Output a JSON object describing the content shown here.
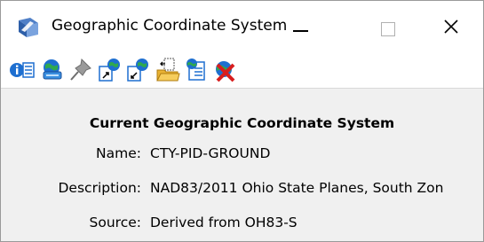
{
  "window": {
    "title": "Geographic Coordinate System",
    "app_icon": "geo-app-icon",
    "controls": {
      "minimize_icon": "minimize-icon",
      "maximize_icon": "maximize-icon",
      "close_icon": "close-icon"
    }
  },
  "toolbar": {
    "tools": [
      {
        "name": "info-list-icon"
      },
      {
        "name": "globe-database-icon"
      },
      {
        "name": "pushpin-icon"
      },
      {
        "name": "export-globe-icon"
      },
      {
        "name": "import-globe-icon"
      },
      {
        "name": "open-folder-icon"
      },
      {
        "name": "globe-list-icon"
      },
      {
        "name": "delete-globe-icon"
      }
    ]
  },
  "panel": {
    "heading": "Current Geographic Coordinate System",
    "name_label": "Name:",
    "name_value": "CTY-PID-GROUND",
    "description_label": "Description:",
    "description_value": "NAD83/2011 Ohio State Planes, South Zon",
    "source_label": "Source:",
    "source_value": "Derived from OH83-S"
  },
  "colors": {
    "title_bar_bg": "#ffffff",
    "panel_bg": "#f0f0f0",
    "accent_blue": "#1e6fd0",
    "accent_green": "#2fa84f",
    "delete_red": "#d81e1e"
  }
}
